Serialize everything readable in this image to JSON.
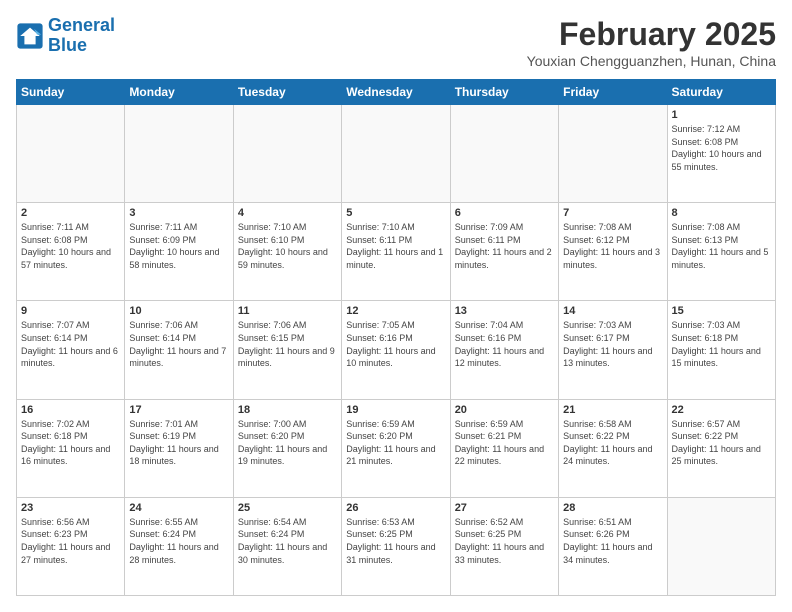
{
  "header": {
    "logo_line1": "General",
    "logo_line2": "Blue",
    "month_year": "February 2025",
    "location": "Youxian Chengguanzhen, Hunan, China"
  },
  "weekdays": [
    "Sunday",
    "Monday",
    "Tuesday",
    "Wednesday",
    "Thursday",
    "Friday",
    "Saturday"
  ],
  "weeks": [
    [
      {
        "day": "",
        "info": ""
      },
      {
        "day": "",
        "info": ""
      },
      {
        "day": "",
        "info": ""
      },
      {
        "day": "",
        "info": ""
      },
      {
        "day": "",
        "info": ""
      },
      {
        "day": "",
        "info": ""
      },
      {
        "day": "1",
        "info": "Sunrise: 7:12 AM\nSunset: 6:08 PM\nDaylight: 10 hours and 55 minutes."
      }
    ],
    [
      {
        "day": "2",
        "info": "Sunrise: 7:11 AM\nSunset: 6:08 PM\nDaylight: 10 hours and 57 minutes."
      },
      {
        "day": "3",
        "info": "Sunrise: 7:11 AM\nSunset: 6:09 PM\nDaylight: 10 hours and 58 minutes."
      },
      {
        "day": "4",
        "info": "Sunrise: 7:10 AM\nSunset: 6:10 PM\nDaylight: 10 hours and 59 minutes."
      },
      {
        "day": "5",
        "info": "Sunrise: 7:10 AM\nSunset: 6:11 PM\nDaylight: 11 hours and 1 minute."
      },
      {
        "day": "6",
        "info": "Sunrise: 7:09 AM\nSunset: 6:11 PM\nDaylight: 11 hours and 2 minutes."
      },
      {
        "day": "7",
        "info": "Sunrise: 7:08 AM\nSunset: 6:12 PM\nDaylight: 11 hours and 3 minutes."
      },
      {
        "day": "8",
        "info": "Sunrise: 7:08 AM\nSunset: 6:13 PM\nDaylight: 11 hours and 5 minutes."
      }
    ],
    [
      {
        "day": "9",
        "info": "Sunrise: 7:07 AM\nSunset: 6:14 PM\nDaylight: 11 hours and 6 minutes."
      },
      {
        "day": "10",
        "info": "Sunrise: 7:06 AM\nSunset: 6:14 PM\nDaylight: 11 hours and 7 minutes."
      },
      {
        "day": "11",
        "info": "Sunrise: 7:06 AM\nSunset: 6:15 PM\nDaylight: 11 hours and 9 minutes."
      },
      {
        "day": "12",
        "info": "Sunrise: 7:05 AM\nSunset: 6:16 PM\nDaylight: 11 hours and 10 minutes."
      },
      {
        "day": "13",
        "info": "Sunrise: 7:04 AM\nSunset: 6:16 PM\nDaylight: 11 hours and 12 minutes."
      },
      {
        "day": "14",
        "info": "Sunrise: 7:03 AM\nSunset: 6:17 PM\nDaylight: 11 hours and 13 minutes."
      },
      {
        "day": "15",
        "info": "Sunrise: 7:03 AM\nSunset: 6:18 PM\nDaylight: 11 hours and 15 minutes."
      }
    ],
    [
      {
        "day": "16",
        "info": "Sunrise: 7:02 AM\nSunset: 6:18 PM\nDaylight: 11 hours and 16 minutes."
      },
      {
        "day": "17",
        "info": "Sunrise: 7:01 AM\nSunset: 6:19 PM\nDaylight: 11 hours and 18 minutes."
      },
      {
        "day": "18",
        "info": "Sunrise: 7:00 AM\nSunset: 6:20 PM\nDaylight: 11 hours and 19 minutes."
      },
      {
        "day": "19",
        "info": "Sunrise: 6:59 AM\nSunset: 6:20 PM\nDaylight: 11 hours and 21 minutes."
      },
      {
        "day": "20",
        "info": "Sunrise: 6:59 AM\nSunset: 6:21 PM\nDaylight: 11 hours and 22 minutes."
      },
      {
        "day": "21",
        "info": "Sunrise: 6:58 AM\nSunset: 6:22 PM\nDaylight: 11 hours and 24 minutes."
      },
      {
        "day": "22",
        "info": "Sunrise: 6:57 AM\nSunset: 6:22 PM\nDaylight: 11 hours and 25 minutes."
      }
    ],
    [
      {
        "day": "23",
        "info": "Sunrise: 6:56 AM\nSunset: 6:23 PM\nDaylight: 11 hours and 27 minutes."
      },
      {
        "day": "24",
        "info": "Sunrise: 6:55 AM\nSunset: 6:24 PM\nDaylight: 11 hours and 28 minutes."
      },
      {
        "day": "25",
        "info": "Sunrise: 6:54 AM\nSunset: 6:24 PM\nDaylight: 11 hours and 30 minutes."
      },
      {
        "day": "26",
        "info": "Sunrise: 6:53 AM\nSunset: 6:25 PM\nDaylight: 11 hours and 31 minutes."
      },
      {
        "day": "27",
        "info": "Sunrise: 6:52 AM\nSunset: 6:25 PM\nDaylight: 11 hours and 33 minutes."
      },
      {
        "day": "28",
        "info": "Sunrise: 6:51 AM\nSunset: 6:26 PM\nDaylight: 11 hours and 34 minutes."
      },
      {
        "day": "",
        "info": ""
      }
    ]
  ]
}
